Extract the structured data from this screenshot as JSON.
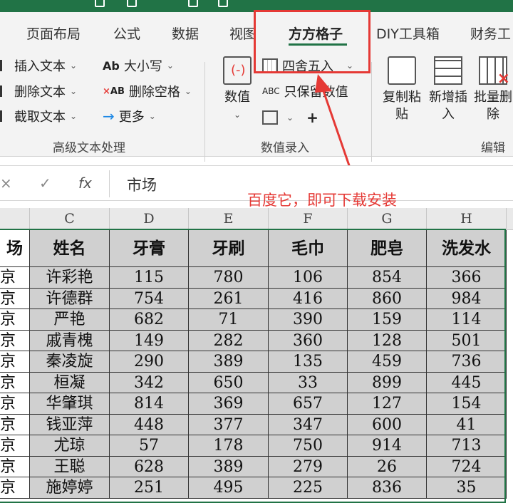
{
  "ribbon": {
    "tabs": [
      {
        "label": "页面布局"
      },
      {
        "label": "公式"
      },
      {
        "label": "数据"
      },
      {
        "label": "视图"
      },
      {
        "label": "方方格子",
        "active": true
      },
      {
        "label": "DIY工具箱"
      },
      {
        "label": "财务工"
      }
    ],
    "text_group": {
      "insert_text": "插入文本",
      "delete_text": "删除文本",
      "extract_text": "截取文本",
      "case": "大小写",
      "delete_space": "删除空格",
      "more": "更多",
      "label": "高级文本处理"
    },
    "value_group": {
      "value_button": "数值",
      "round": "四舍五入",
      "keep_value": "只保留数值",
      "label": "数值录入"
    },
    "edit_group": {
      "copy_paste": "复制粘贴",
      "new_insert": "新增插入",
      "batch_delete": "批量删除",
      "label": "编辑"
    }
  },
  "formula_bar": {
    "value": "市场"
  },
  "annotation": "百度它，即可下载安装",
  "sheet": {
    "column_letters": [
      "C",
      "D",
      "E",
      "F",
      "G",
      "H"
    ],
    "partial_header": "场",
    "headers": [
      "姓名",
      "牙膏",
      "牙刷",
      "毛巾",
      "肥皂",
      "洗发水"
    ],
    "partial_cell": "京",
    "rows": [
      [
        "许彩艳",
        "115",
        "780",
        "106",
        "854",
        "366"
      ],
      [
        "许德群",
        "754",
        "261",
        "416",
        "860",
        "984"
      ],
      [
        "严艳",
        "682",
        "71",
        "390",
        "159",
        "114"
      ],
      [
        "戚青槐",
        "149",
        "282",
        "360",
        "128",
        "501"
      ],
      [
        "秦凌旋",
        "290",
        "389",
        "135",
        "459",
        "736"
      ],
      [
        "桓凝",
        "342",
        "650",
        "33",
        "899",
        "445"
      ],
      [
        "华肇琪",
        "814",
        "369",
        "657",
        "127",
        "154"
      ],
      [
        "钱亚萍",
        "448",
        "377",
        "347",
        "600",
        "41"
      ],
      [
        "尤琼",
        "57",
        "178",
        "750",
        "914",
        "713"
      ],
      [
        "王聪",
        "628",
        "389",
        "279",
        "26",
        "724"
      ],
      [
        "施婷婷",
        "251",
        "495",
        "225",
        "836",
        "35"
      ]
    ]
  },
  "colors": {
    "accent": "#217346",
    "highlight": "#e53935",
    "cell_fill": "#d0d0d0"
  }
}
